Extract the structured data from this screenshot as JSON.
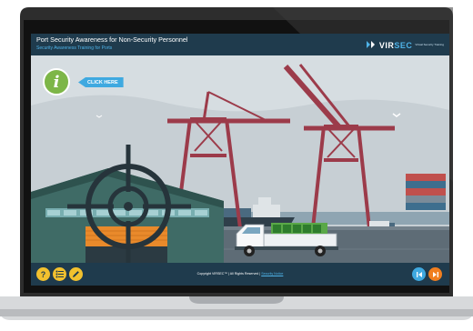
{
  "course": {
    "title": "Port Security Awareness for Non-Security Personnel",
    "subtitle": "Security Awareness Training for Ports"
  },
  "logo": {
    "text": "VIR",
    "text_accent": "SEC",
    "tagline": "Virtual Security Training"
  },
  "hint": {
    "info_glyph": "i",
    "click_label": "CLICK HERE"
  },
  "footer": {
    "help_label": "?",
    "copyright_text": "Copyright VIRSEC™ | All Rights Reserved |",
    "policy_link": "Security Notice"
  },
  "icons": {
    "help": "help-icon",
    "menu": "list-menu-icon",
    "notes": "pencil-icon",
    "back": "skip-back-icon",
    "next": "skip-next-icon",
    "target": "crosshair-icon"
  },
  "colors": {
    "header_bg": "#1f3b4d",
    "accent_blue": "#4fb3e8",
    "button_yellow": "#f2c12e",
    "info_green": "#7db648",
    "nav_blue": "#3fa9e0",
    "nav_orange": "#f07e1f",
    "crane_red": "#9c3b4a"
  }
}
